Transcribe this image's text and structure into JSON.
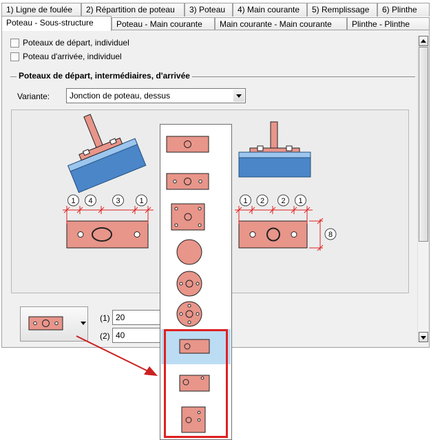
{
  "tabs_row1": [
    {
      "label": "1) Ligne de foulée"
    },
    {
      "label": "2) Répartition de poteau"
    },
    {
      "label": "3) Poteau"
    },
    {
      "label": "4) Main courante"
    },
    {
      "label": "5) Remplissage"
    },
    {
      "label": "6) Plinthe"
    }
  ],
  "tabs_row2": [
    {
      "label": "Poteau - Sous-structure",
      "active": true
    },
    {
      "label": "Poteau - Main courante"
    },
    {
      "label": "Main courante - Main courante"
    },
    {
      "label": "Plinthe - Plinthe"
    }
  ],
  "checkboxes": [
    {
      "label": "Poteaux de départ, individuel",
      "checked": false
    },
    {
      "label": "Poteau d'arrivée, individuel",
      "checked": false
    }
  ],
  "section": {
    "title": "Poteaux de départ, intermédiaires, d'arrivée"
  },
  "variant": {
    "label": "Variante:",
    "value": "Jonction de poteau, dessus"
  },
  "dimensions_left": [
    "1",
    "4",
    "3",
    "1"
  ],
  "dimensions_right": [
    "1",
    "2",
    "2",
    "1"
  ],
  "dimension_height": "8",
  "params": [
    {
      "label": "(1)",
      "value": "20"
    },
    {
      "label": "(2)",
      "value": "40"
    }
  ],
  "plate_options": [
    "plate-rect-one-hole",
    "plate-rect-three-holes",
    "plate-square-four-holes",
    "plate-circle-plain",
    "plate-circle-two-holes",
    "plate-circle-four-holes",
    "plate-rect-one-hole-offset",
    "plate-rect-one-hole-corner",
    "plate-square-three-holes"
  ],
  "colors": {
    "plate_fill": "#e8958a",
    "beam_fill": "#4a86c8",
    "dimension_red": "#e02020",
    "selection": "#bcdcf4",
    "highlight_frame": "#e02020"
  }
}
